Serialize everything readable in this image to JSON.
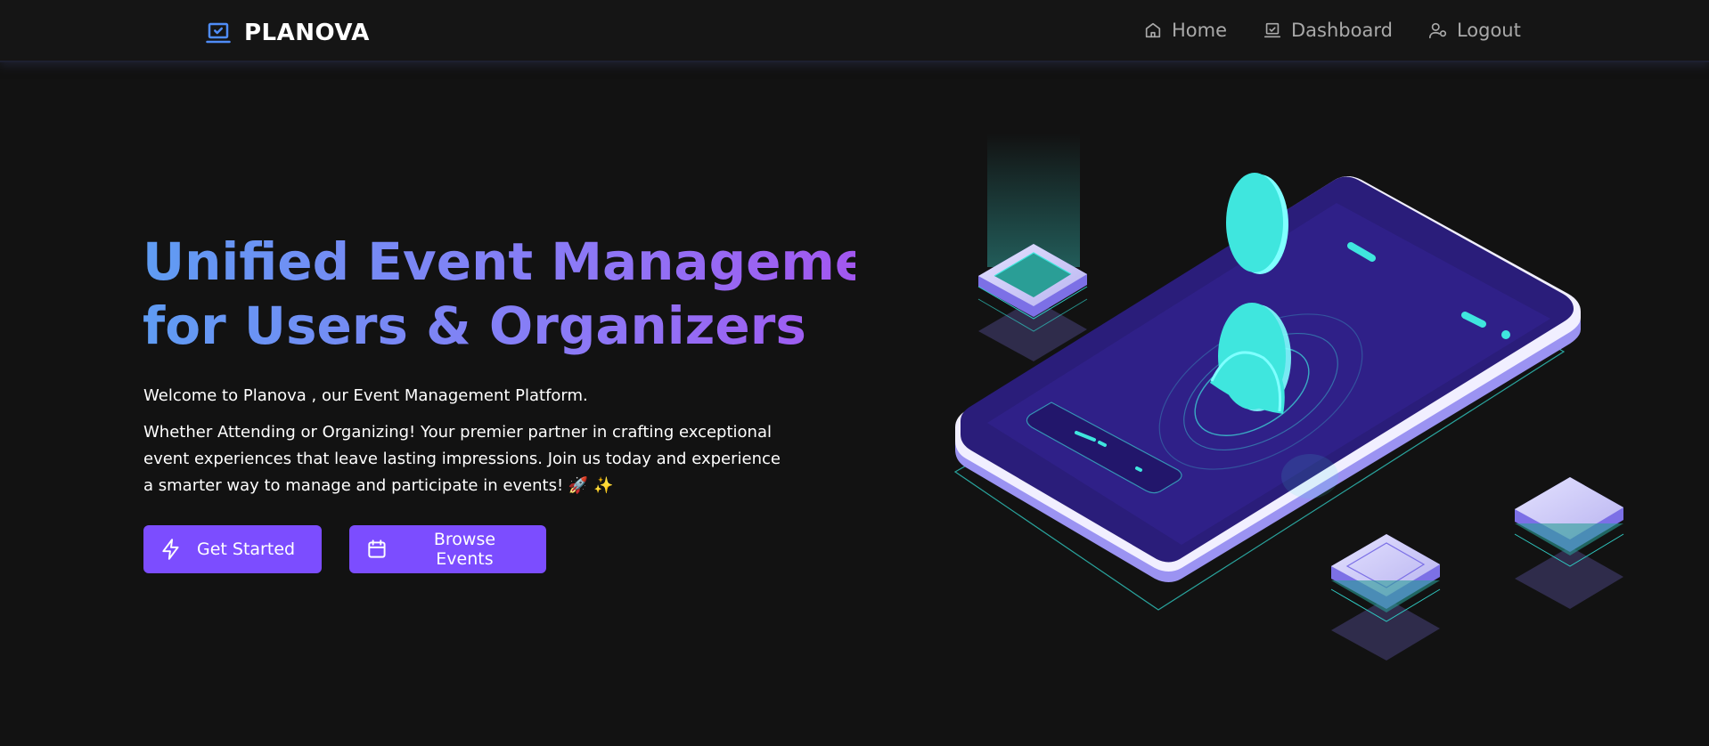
{
  "brand": {
    "name": "PLANOVA",
    "icon": "laptop-check-icon",
    "accent": "#4f8cf7"
  },
  "nav": [
    {
      "label": "Home",
      "icon": "home-icon"
    },
    {
      "label": "Dashboard",
      "icon": "dashboard-icon"
    },
    {
      "label": "Logout",
      "icon": "user-logout-icon"
    }
  ],
  "hero": {
    "title_line1": "Unified Event Management",
    "title_line2": "for Users & Organizers",
    "intro": "Welcome to Planova , our Event Management Platform.",
    "description": "Whether Attending or Organizing! Your premier partner in crafting exceptional event experiences that leave lasting impressions. Join us today and experience a smarter way to manage and participate in events! 🚀 ✨",
    "buttons": [
      {
        "label": "Get Started",
        "icon": "lightning-icon"
      },
      {
        "label": "Browse Events",
        "icon": "calendar-icon"
      }
    ]
  },
  "colors": {
    "background": "#121212",
    "button": "#7c4dff",
    "gradient_start": "#5f9cf3",
    "gradient_end": "#a257f0",
    "illustration_cyan": "#3fe6de",
    "illustration_purple": "#2a1d7a"
  }
}
